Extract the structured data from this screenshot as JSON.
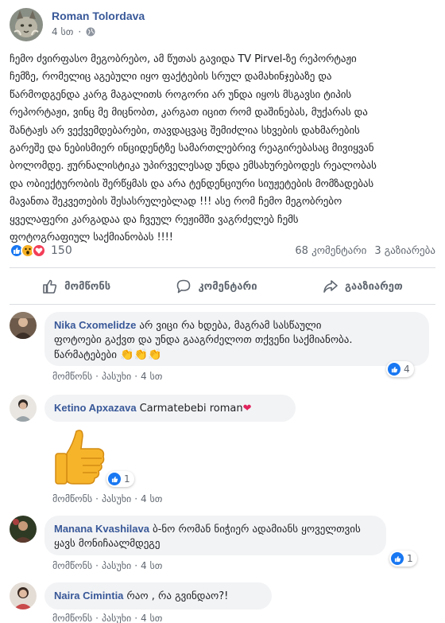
{
  "post": {
    "author": "Roman Tolordava",
    "time": "4 სთ",
    "lines": [
      "ჩემო ძვირფასო მეგობრებო, ამ წუთას გავიდა TV Pirvel-ზე რეპორტაჟი",
      "ჩემზე, რომელიც აგებული იყო ფაქტების სრულ დამახინჯებაზე და",
      "წარმოდგენდა კარგ მაგალითს როგორი არ უნდა იყოს მსგავსი ტიპის",
      "რეპორტაჟი, ვინც მე მიცნობთ, კარგათ იცით რომ დაშინებას, მუქარას და",
      "შანტაჟს არ ვექვემდებარები, თავდაცვაც შემიძლია სხვების დახმარების",
      "გარეშე და ნებისმიერ ინციდენტზე სამართლებრივ რეაგირებასაც მივიყვან",
      "ბოლომდე. ჟურნალისტიკა უპირველესად უნდა ემსახურებოდეს რეალობას",
      "და ობიექტურობის შერწყმას და არა ტენდენციური სიუჟეტების მომზადებას",
      "მავანთა შეკვეთების შესასრულებლად !!! ასე რომ ჩემო მეგობრებო",
      "ყველაფერი კარგადაა და ჩვეულ რეჟიმში ვაგრძელებ ჩემს",
      "ფოტოგრაფიულ საქმიანობას !!!!"
    ]
  },
  "reactions": {
    "count": "150",
    "comments": "68 კომენტარი",
    "shares": "3 გაზიარება",
    "colors": {
      "like": "#1877f2",
      "wow": "#f7b125",
      "love": "#f33e58"
    }
  },
  "actions": {
    "like": "მომწონს",
    "comment": "კომენტარი",
    "share": "გააზიარეთ"
  },
  "comments": [
    {
      "name": "Nika Cxomelidze",
      "lines": [
        "არ ვიცი რა ხდება, მაგრამ სასწაული",
        "ფოტოები გაქვთ და უნდა გააგრძელოთ თქვენი საქმიანობა.",
        "წარმატებები"
      ],
      "emoji": "👏👏👏",
      "like": "მომწონს",
      "reply": "პასუხი",
      "time": "4 სთ",
      "reaction_count": "4"
    },
    {
      "name": "Ketino Apxazava",
      "lines": [
        "Carmatebebi roman"
      ],
      "emoji": "❤",
      "sticker": "thumbs-up-sticker",
      "like": "მომწონს",
      "reply": "პასუხი",
      "time": "4 სთ",
      "reaction_count": "1"
    },
    {
      "name": "Manana Kvashilava",
      "lines": [
        "ბ-ნო რომან ნიჭიერ ადამიანს ყოველთვის",
        "ყავს მონიჩაალმდეგე"
      ],
      "like": "მომწონს",
      "reply": "პასუხი",
      "time": "4 სთ",
      "reaction_count": "1"
    },
    {
      "name": "Naira Cimintia",
      "lines": [
        "რაო , რა გვინდაო?!"
      ],
      "like": "მომწონს",
      "reply": "პასუხი",
      "time": "4 სთ"
    }
  ],
  "separator": "·"
}
